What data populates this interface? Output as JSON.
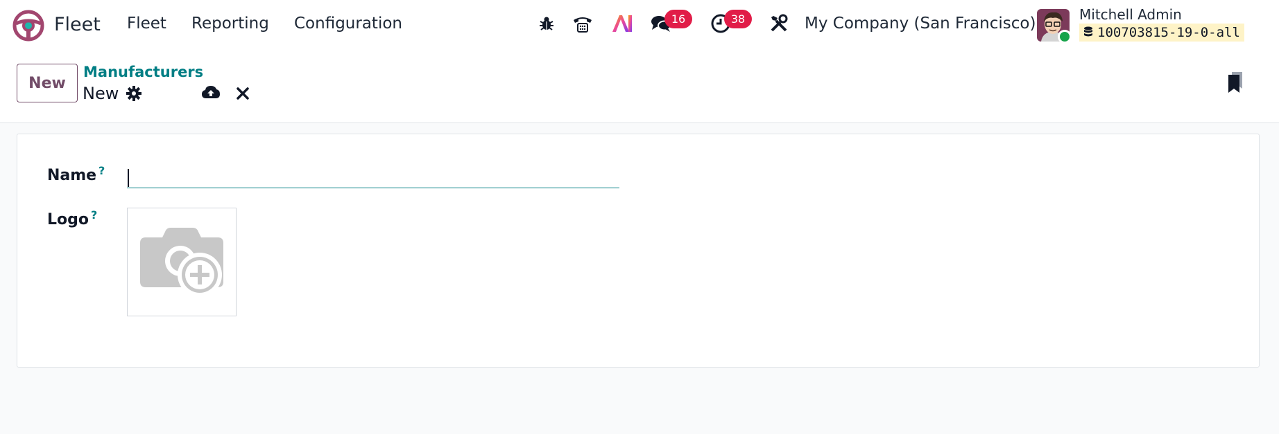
{
  "navbar": {
    "app_name": "Fleet",
    "menu": [
      {
        "label": "Fleet"
      },
      {
        "label": "Reporting"
      },
      {
        "label": "Configuration"
      }
    ],
    "systray": {
      "messages_count": "16",
      "activities_count": "38",
      "company": "My Company (San Francisco)",
      "user_name": "Mitchell Admin",
      "database": "100703815-19-0-all"
    },
    "icons": [
      "debug-icon",
      "phone-icon",
      "ai-icon",
      "chat-icon",
      "clock-icon",
      "tools-icon",
      "database-icon"
    ],
    "colors": {
      "badge": "#e11d48",
      "brand": "#714b67",
      "accent": "#017e84",
      "db_pill": "#fef3c7"
    }
  },
  "control_panel": {
    "new_button": "New",
    "breadcrumb": "Manufacturers",
    "record_title": "New"
  },
  "form": {
    "name_label": "Name",
    "name_help": "?",
    "name_value": "",
    "logo_label": "Logo",
    "logo_help": "?"
  }
}
